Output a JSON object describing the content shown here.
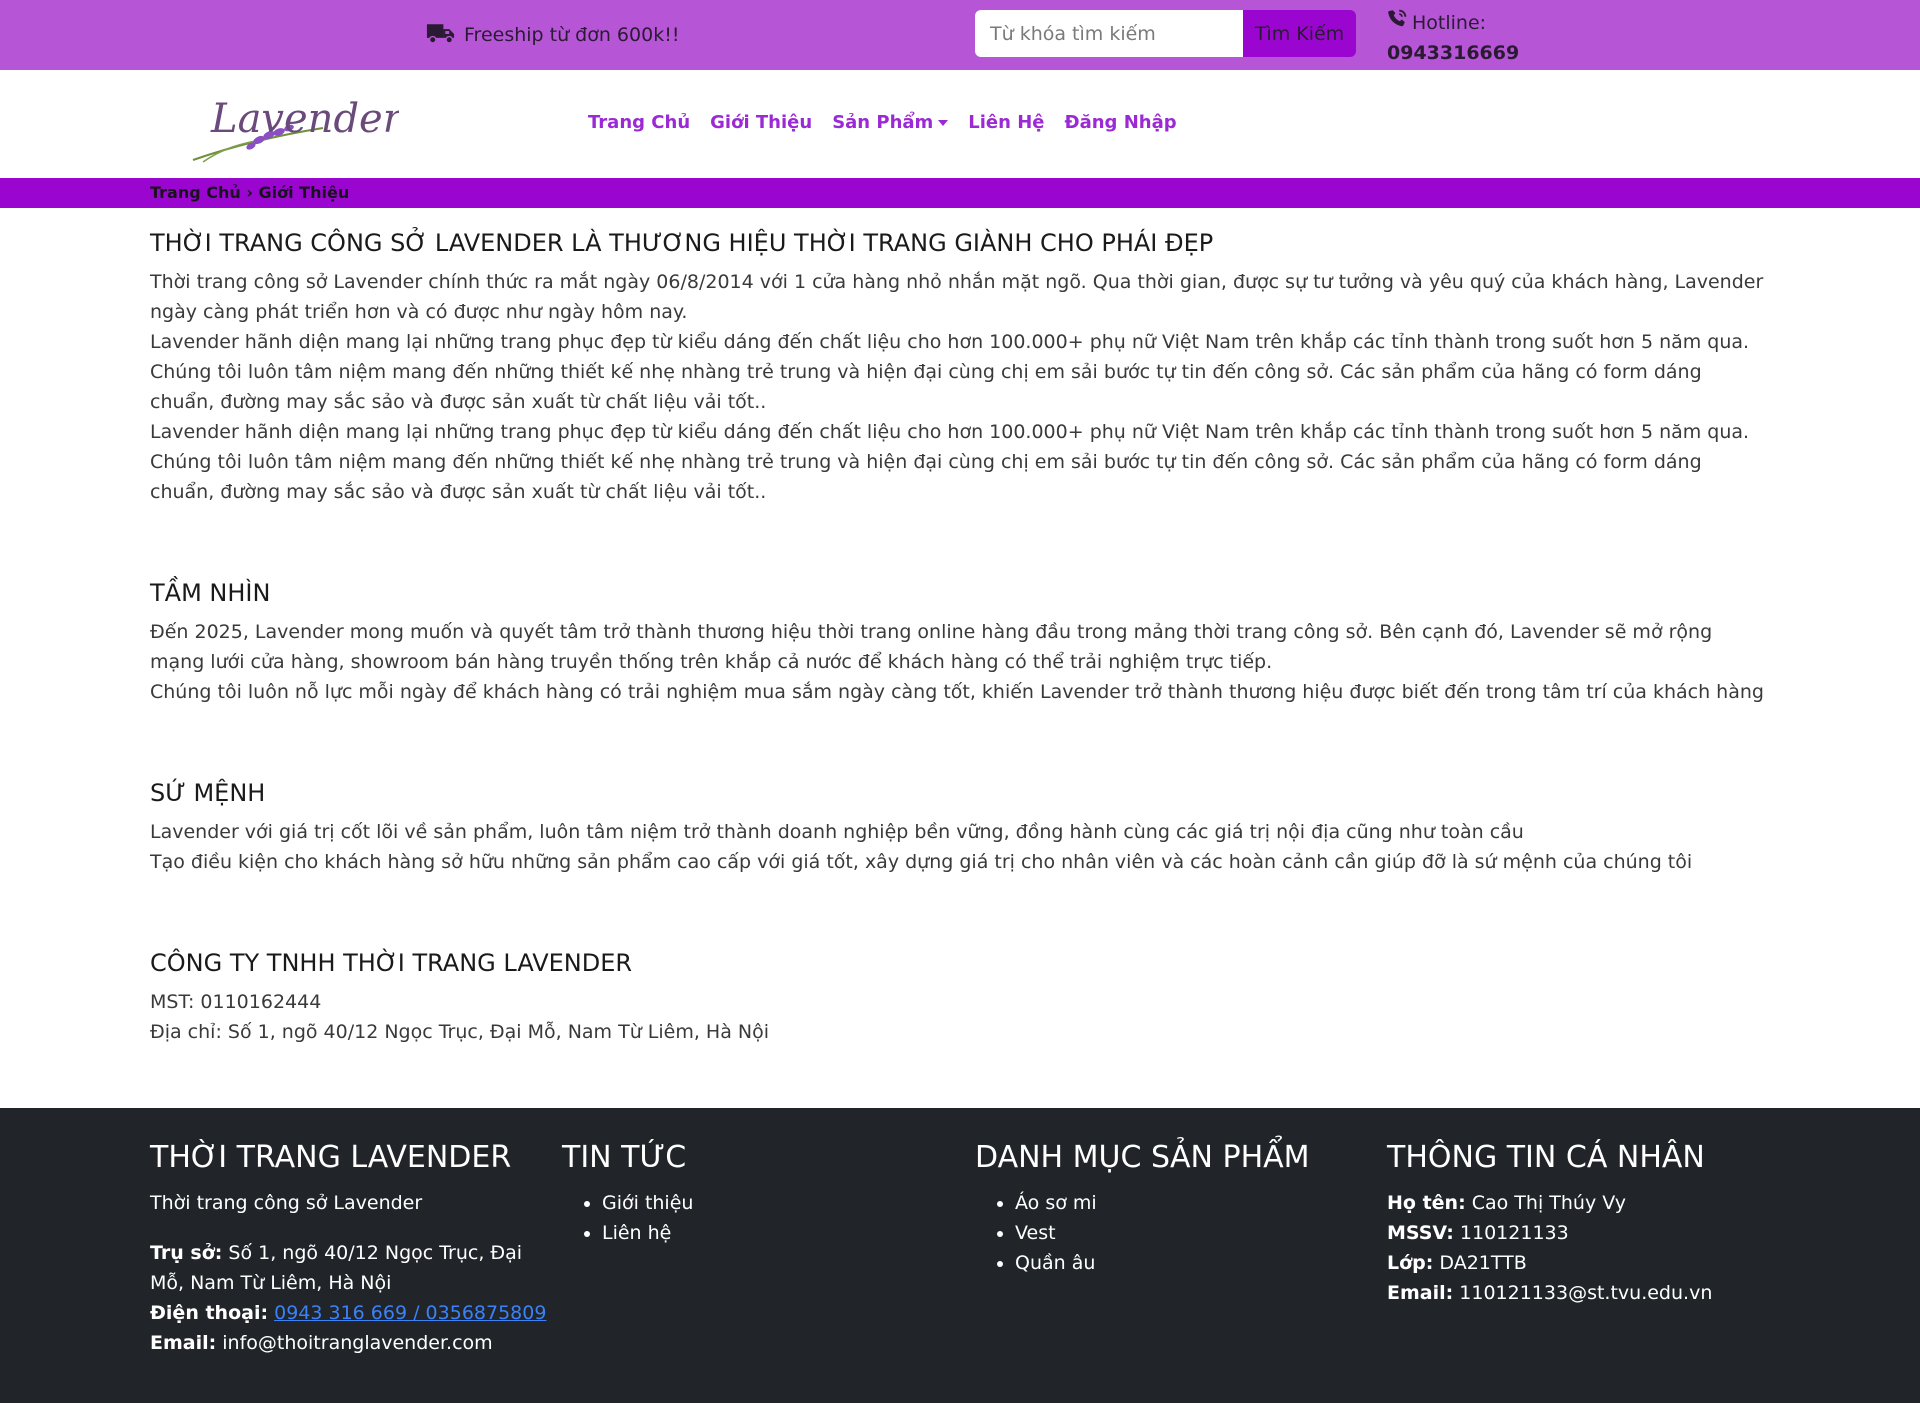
{
  "topbar": {
    "freeship_text": "Freeship từ đơn 600k!!",
    "search_placeholder": "Từ khóa tìm kiếm",
    "search_button": "Tìm Kiếm",
    "hotline_label": "Hotline:",
    "hotline_number": "0943316669"
  },
  "header": {
    "logo_text": "Lavender",
    "nav": {
      "home": "Trang Chủ",
      "about": "Giới Thiệu",
      "products": "Sản Phẩm",
      "contact": "Liên Hệ",
      "login": "Đăng Nhập"
    }
  },
  "breadcrumb": {
    "text": "Trang Chủ › Giới Thiệu"
  },
  "main": {
    "intro_title": "THỜI TRANG CÔNG SỞ LAVENDER LÀ THƯƠNG HIỆU THỜI TRANG GIÀNH CHO PHÁI ĐẸP",
    "intro_p1": "Thời trang công sở Lavender chính thức ra mắt ngày 06/8/2014 với 1 cửa hàng nhỏ nhắn mặt ngõ. Qua thời gian, được sự tư tưởng và yêu quý của khách hàng, Lavender ngày càng phát triển hơn và có được như ngày hôm nay.",
    "intro_p2": "Lavender hãnh diện mang lại những trang phục đẹp từ kiểu dáng đến chất liệu cho hơn 100.000+ phụ nữ Việt Nam trên khắp các tỉnh thành trong suốt hơn 5 năm qua. Chúng tôi luôn tâm niệm mang đến những thiết kế nhẹ nhàng trẻ trung và hiện đại cùng chị em sải bước tự tin đến công sở. Các sản phẩm của hãng có form dáng chuẩn, đường may sắc sảo và được sản xuất từ chất liệu vải tốt..",
    "intro_p3": "Lavender hãnh diện mang lại những trang phục đẹp từ kiểu dáng đến chất liệu cho hơn 100.000+ phụ nữ Việt Nam trên khắp các tỉnh thành trong suốt hơn 5 năm qua. Chúng tôi luôn tâm niệm mang đến những thiết kế nhẹ nhàng trẻ trung và hiện đại cùng chị em sải bước tự tin đến công sở. Các sản phẩm của hãng có form dáng chuẩn, đường may sắc sảo và được sản xuất từ chất liệu vải tốt..",
    "vision_title": "TẦM NHÌN",
    "vision_p1": "Đến 2025, Lavender mong muốn và quyết tâm trở thành thương hiệu thời trang online hàng đầu trong mảng thời trang công sở. Bên cạnh đó, Lavender sẽ mở rộng mạng lưới cửa hàng, showroom bán hàng truyền thống trên khắp cả nước để khách hàng có thể trải nghiệm trực tiếp.",
    "vision_p2": "Chúng tôi luôn nỗ lực mỗi ngày để khách hàng có trải nghiệm mua sắm ngày càng tốt, khiến Lavender trở thành thương hiệu được biết đến trong tâm trí của khách hàng",
    "mission_title": "SỨ MỆNH",
    "mission_p1": "Lavender với giá trị cốt lõi về sản phẩm, luôn tâm niệm trở thành doanh nghiệp bền vững, đồng hành cùng các giá trị nội địa cũng như toàn cầu",
    "mission_p2": "Tạo điều kiện cho khách hàng sở hữu những sản phẩm cao cấp với giá tốt, xây dựng giá trị cho nhân viên và các hoàn cảnh cần giúp đỡ là sứ mệnh của chúng tôi",
    "company_title": "CÔNG TY TNHH THỜI TRANG LAVENDER",
    "company_mst": "MST: 0110162444",
    "company_address": "Địa chỉ: Số 1, ngõ 40/12 Ngọc Trục, Đại Mỗ, Nam Từ Liêm, Hà Nội"
  },
  "footer": {
    "col1": {
      "title": "THỜI TRANG LAVENDER",
      "subtitle": "Thời trang công sở Lavender",
      "office_label": "Trụ sở:",
      "office_value": "Số 1, ngõ 40/12 Ngọc Trục, Đại Mỗ, Nam Từ Liêm, Hà Nội",
      "phone_label": "Điện thoại:",
      "phone_value": "0943 316 669 / 0356875809",
      "email_label": "Email:",
      "email_value": "info@thoitranglavender.com"
    },
    "col2": {
      "title": "TIN TỨC",
      "items": [
        "Giới thiệu",
        "Liên hệ"
      ]
    },
    "col3": {
      "title": "DANH MỤC SẢN PHẨM",
      "items": [
        "Áo sơ mi",
        "Vest",
        "Quần âu"
      ]
    },
    "col4": {
      "title": "THÔNG TIN CÁ NHÂN",
      "name_label": "Họ tên:",
      "name_value": "Cao Thị Thúy Vy",
      "id_label": "MSSV:",
      "id_value": "110121133",
      "class_label": "Lớp:",
      "class_value": "DA21TTB",
      "email_label": "Email:",
      "email_value": "110121133@st.tvu.edu.vn"
    }
  },
  "colors": {
    "topbar": "#b656d6",
    "accent": "#9a06cf",
    "nav_text": "#9b2ad4",
    "footer_bg": "#212529"
  }
}
